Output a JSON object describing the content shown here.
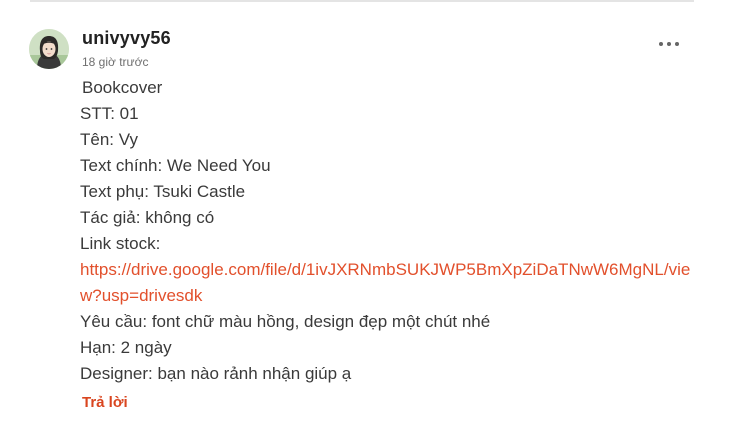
{
  "comment": {
    "username": "univyvy56",
    "timestamp": "18 giờ trước",
    "more_icon": "more-horizontal-icon",
    "lines": {
      "l1": "Bookcover",
      "l2": "STT: 01",
      "l3": "Tên: Vy",
      "l4": "Text chính: We Need You",
      "l5": "Text phụ: Tsuki Castle",
      "l6": "Tác giả: không có",
      "l7": "Link stock:",
      "link": "https://drive.google.com/file/d/1ivJXRNmbSUKJWP5BmXpZiDaTNwW6MgNL/view?usp=drivesdk",
      "l8": "Yêu cầu: font chữ màu hồng, design đẹp một chút nhé",
      "l9": "Hạn: 2 ngày",
      "l10": "Designer: bạn nào rảnh nhận giúp ạ"
    },
    "reply_label": "Trả lời",
    "colors": {
      "link": "#e2502c",
      "reply": "#d9451f"
    }
  }
}
